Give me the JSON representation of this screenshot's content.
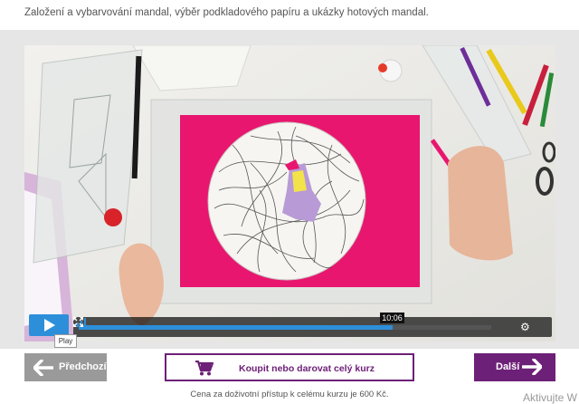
{
  "course": {
    "description": "Založení a vybarvování mandal, výběr podkladového papíru a ukázky hotových mandal."
  },
  "player": {
    "play_tooltip": "Play",
    "current_time": "10:06",
    "progress_fraction": 0.76,
    "accent_color": "#2d8fd9",
    "icons": [
      "play-icon",
      "volume-icon",
      "gear-icon",
      "fullscreen-icon"
    ]
  },
  "navigation": {
    "prev_label": "Předchozí",
    "buy_label": "Koupit nebo darovat celý kurz",
    "next_label": "Další",
    "brand_color": "#6d2077",
    "prev_color": "#9a9a9a"
  },
  "footer": {
    "price_note": "Cena za doživotní přístup k celému kurzu je 600 Kč.",
    "watermark": "Aktivujte W"
  }
}
